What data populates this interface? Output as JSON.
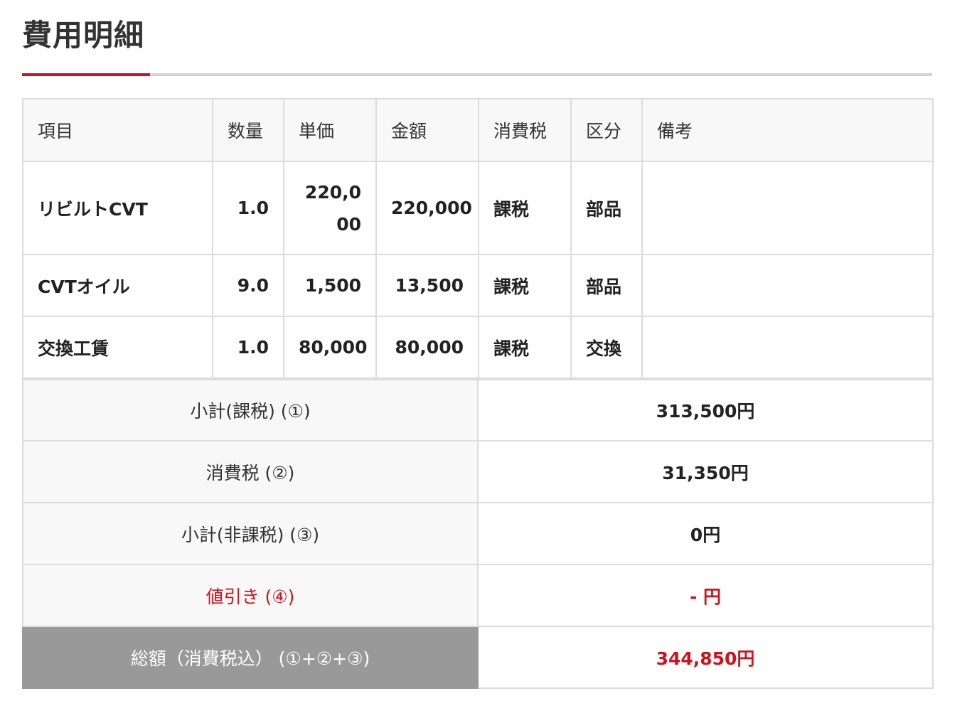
{
  "title": "費用明細",
  "colors": {
    "accent": "#d0121b",
    "header_bg": "#f8f8f8",
    "total_bg": "#999999"
  },
  "table": {
    "headers": [
      "項目",
      "数量",
      "単価",
      "金額",
      "消費税",
      "区分",
      "備考"
    ],
    "rows": [
      {
        "item": "リビルトCVT",
        "qty": "1.0",
        "unit_price": "220,000",
        "amount": "220,000",
        "tax": "課税",
        "category": "部品",
        "note": ""
      },
      {
        "item": "CVTオイル",
        "qty": "9.0",
        "unit_price": "1,500",
        "amount": "13,500",
        "tax": "課税",
        "category": "部品",
        "note": ""
      },
      {
        "item": "交換工賃",
        "qty": "1.0",
        "unit_price": "80,000",
        "amount": "80,000",
        "tax": "課税",
        "category": "交換",
        "note": ""
      }
    ]
  },
  "summary": {
    "subtotal_taxable": {
      "label": "小計(課税) (①)",
      "value": "313,500円"
    },
    "consumption_tax": {
      "label": "消費税 (②)",
      "value": "31,350円"
    },
    "subtotal_nontaxable": {
      "label": "小計(非課税) (③)",
      "value": "0円"
    },
    "discount": {
      "label": "値引き (④)",
      "value": "- 円"
    },
    "total": {
      "label": "総額（消費税込） (①+②+③)",
      "value": "344,850円"
    }
  }
}
